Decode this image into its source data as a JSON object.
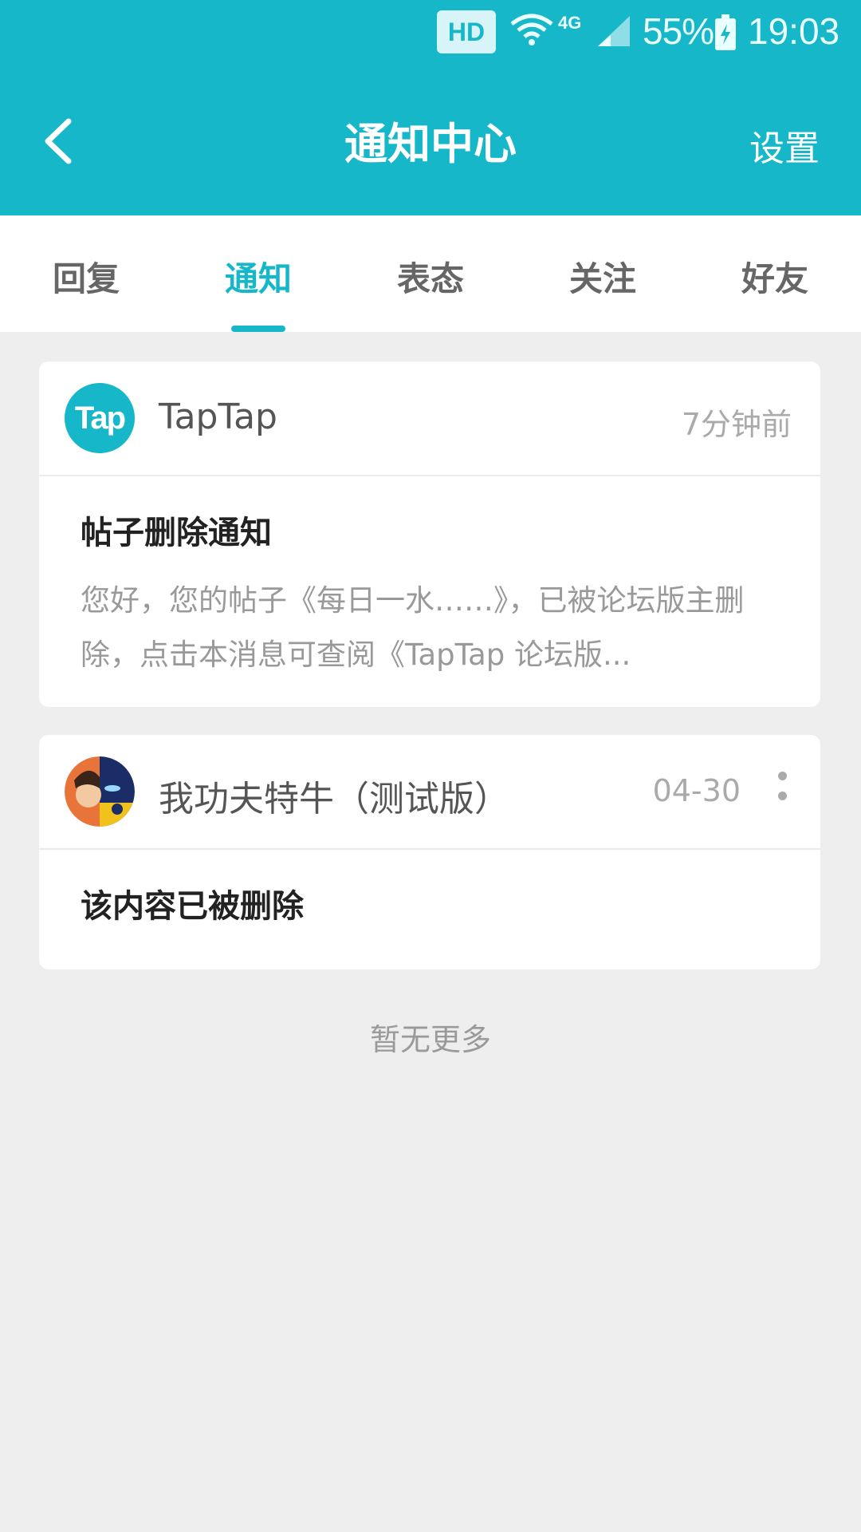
{
  "status_bar": {
    "hd": "HD",
    "network": "4G",
    "battery": "55%",
    "time": "19:03"
  },
  "header": {
    "title": "通知中心",
    "settings_label": "设置"
  },
  "tabs": [
    {
      "label": "回复",
      "active": false
    },
    {
      "label": "通知",
      "active": true
    },
    {
      "label": "表态",
      "active": false
    },
    {
      "label": "关注",
      "active": false
    },
    {
      "label": "好友",
      "active": false
    }
  ],
  "notifications": [
    {
      "avatar_text": "Tap",
      "sender": "TapTap",
      "time": "7分钟前",
      "title": "帖子删除通知",
      "text": "您好，您的帖子《每日一水……》，已被论坛版主删除，点击本消息可查阅《TapTap 论坛版..."
    },
    {
      "sender": "我功夫特牛（测试版）",
      "time": "04-30",
      "title": "该内容已被删除"
    }
  ],
  "footer": {
    "no_more": "暂无更多"
  },
  "colors": {
    "accent": "#15b7c8",
    "background": "#eeeeee"
  }
}
